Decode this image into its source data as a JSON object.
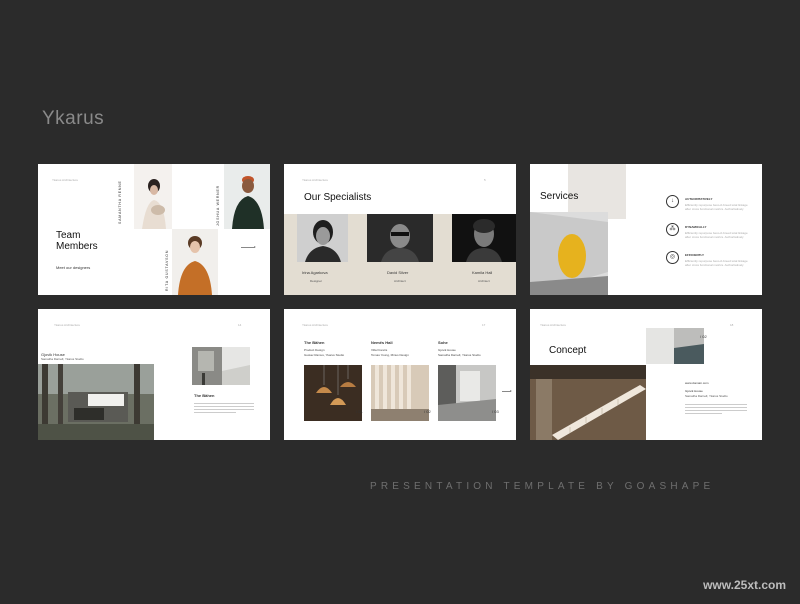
{
  "brand": "Ykarus",
  "tagline": "PRESENTATION TEMPLATE BY GOASHAPE",
  "watermark": "www.25xt.com",
  "header_small": "Ykarus Architecture",
  "slide1": {
    "title_line1": "Team",
    "title_line2": "Members",
    "subtitle": "Meet our designers",
    "names": [
      "SAMANTHA RENNE",
      "JOSHUA WERNER",
      "RITA GUSTAVSON"
    ]
  },
  "slide2": {
    "title": "Our Specialists",
    "page": "5",
    "people": [
      {
        "name": "Irina Agarkova",
        "role": "Designer"
      },
      {
        "name": "David Silver",
        "role": "Architect"
      },
      {
        "name": "Kamila Hall",
        "role": "Architect"
      }
    ]
  },
  "slide3": {
    "title": "Services",
    "items": [
      {
        "icon": "arrow-icon",
        "title": "AUTHORITATIVELY",
        "desc_line1": "Efficiently repurpose best-of-breed total linkage",
        "desc_line2": "after cross functional metrics. Authoritatively"
      },
      {
        "icon": "nodes-icon",
        "title": "DYNAMICALLY",
        "desc_line1": "Efficiently repurpose best-of-breed total linkage",
        "desc_line2": "after cross functional metrics. Authoritatively"
      },
      {
        "icon": "target-icon",
        "title": "EFFICIENTLY",
        "desc_line1": "Efficiently repurpose best-of-breed total linkage",
        "desc_line2": "after cross functional metrics. Authoritatively"
      }
    ]
  },
  "slide4": {
    "project": "Gjovik House",
    "credits": "Samatha Darnell, Ykarus Studio",
    "caption_title": "The Bähen",
    "page": "14"
  },
  "slide5": {
    "page": "17",
    "projects": [
      {
        "title": "The Bähen",
        "line1": "Product Design",
        "line2": "Gustav Ramus, Ykarus Studio",
        "num": "/ 01"
      },
      {
        "title": "Nemës Hall",
        "line1": "Villa Francis",
        "line2": "Tomas Young, Minus Design",
        "num": "/ 02"
      },
      {
        "title": "Sohe",
        "line1": "Gjovik House",
        "line2": "Samatha Darnell, Ykarus Studio",
        "num": "/ 03"
      }
    ]
  },
  "slide6": {
    "title": "Concept",
    "page": "18",
    "num": "/ 02",
    "website": "www.domain.com",
    "project": "Gjovik House",
    "credits": "Samatha Darnell, Ykarus Studio"
  },
  "colors": {
    "background": "#2b2b2b",
    "yellow": "#e6b21e",
    "beige": "#e3ddd2"
  }
}
